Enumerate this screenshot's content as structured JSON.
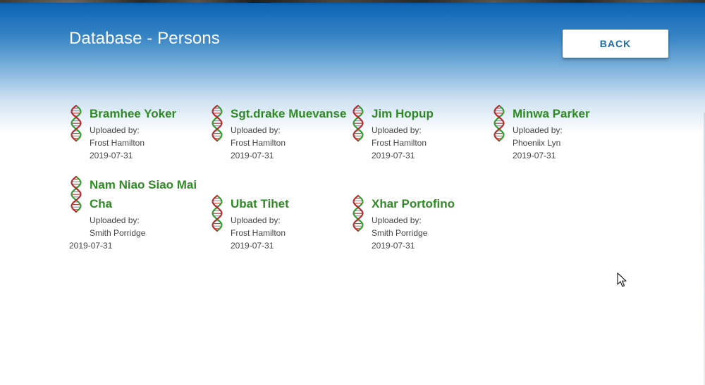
{
  "page": {
    "title": "Database - Persons"
  },
  "toolbar": {
    "back_label": "BACK"
  },
  "colors": {
    "accent": "#0d64b3",
    "name": "#2f8a25",
    "meta": "#444444"
  },
  "icons": {
    "record": "dna-icon",
    "pointer": "mouse-cursor-icon"
  },
  "persons": [
    {
      "name": "Bramhee Yoker",
      "uploaded_by_label": "Uploaded by:",
      "uploader": "Frost Hamilton",
      "date": "2019-07-31"
    },
    {
      "name": "Sgt.drake Muevanse",
      "uploaded_by_label": "Uploaded by:",
      "uploader": "Frost Hamilton",
      "date": "2019-07-31"
    },
    {
      "name": "Jim Hopup",
      "uploaded_by_label": "Uploaded by:",
      "uploader": "Frost Hamilton",
      "date": "2019-07-31"
    },
    {
      "name": "Minwa Parker",
      "uploaded_by_label": "Uploaded by:",
      "uploader": "Phoeniix Lyn",
      "date": "2019-07-31"
    },
    {
      "name_line1": "Nam Niao Siao Mai",
      "name_line2": "Cha",
      "uploaded_by_label": "Uploaded by:",
      "uploader": "Smith Porridge",
      "date": "2019-07-31"
    },
    {
      "name": "Ubat Tihet",
      "uploaded_by_label": "Uploaded by:",
      "uploader": "Frost Hamilton",
      "date": "2019-07-31"
    },
    {
      "name": "Xhar Portofino",
      "uploaded_by_label": "Uploaded by:",
      "uploader": "Smith Porridge",
      "date": "2019-07-31"
    }
  ]
}
